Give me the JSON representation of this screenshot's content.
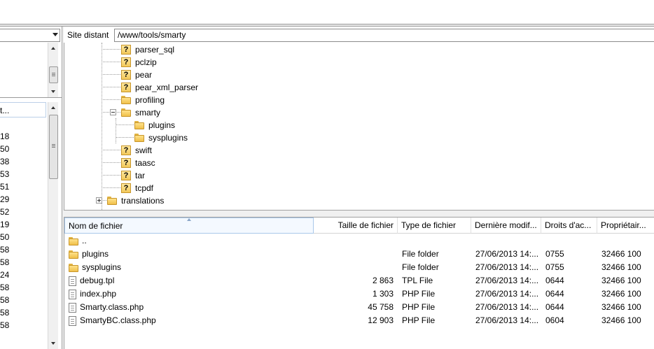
{
  "local": {
    "list_header": "t...",
    "numbers": [
      "18",
      "50",
      "38",
      "53",
      "51",
      "29",
      "52",
      "19",
      "50",
      "58",
      "58",
      "24",
      "58",
      "58",
      "58",
      "58"
    ]
  },
  "remote": {
    "site_label": "Site distant :",
    "path": "/www/tools/smarty",
    "tree": [
      {
        "name": "parser_sql",
        "icon": "unknown-folder-icon"
      },
      {
        "name": "pclzip",
        "icon": "unknown-folder-icon"
      },
      {
        "name": "pear",
        "icon": "unknown-folder-icon"
      },
      {
        "name": "pear_xml_parser",
        "icon": "unknown-folder-icon"
      },
      {
        "name": "profiling",
        "icon": "folder-icon"
      },
      {
        "name": "smarty",
        "icon": "folder-icon",
        "expanded": true
      },
      {
        "name": "plugins",
        "icon": "folder-icon"
      },
      {
        "name": "sysplugins",
        "icon": "folder-icon"
      },
      {
        "name": "swift",
        "icon": "unknown-folder-icon"
      },
      {
        "name": "taasc",
        "icon": "unknown-folder-icon"
      },
      {
        "name": "tar",
        "icon": "unknown-folder-icon"
      },
      {
        "name": "tcpdf",
        "icon": "unknown-folder-icon"
      },
      {
        "name": "translations",
        "icon": "folder-icon",
        "expandable": true
      }
    ],
    "columns": [
      "Nom de fichier",
      "Taille de fichier",
      "Type de fichier",
      "Dernière modif...",
      "Droits d'ac...",
      "Propriétair..."
    ],
    "files": [
      {
        "name": "..",
        "size": "",
        "type": "",
        "modified": "",
        "perms": "",
        "owner": "",
        "icon": "folder-icon"
      },
      {
        "name": "plugins",
        "size": "",
        "type": "File folder",
        "modified": "27/06/2013 14:...",
        "perms": "0755",
        "owner": "32466 100",
        "icon": "folder-icon"
      },
      {
        "name": "sysplugins",
        "size": "",
        "type": "File folder",
        "modified": "27/06/2013 14:...",
        "perms": "0755",
        "owner": "32466 100",
        "icon": "folder-icon"
      },
      {
        "name": "debug.tpl",
        "size": "2 863",
        "type": "TPL File",
        "modified": "27/06/2013 14:...",
        "perms": "0644",
        "owner": "32466 100",
        "icon": "file-icon"
      },
      {
        "name": "index.php",
        "size": "1 303",
        "type": "PHP File",
        "modified": "27/06/2013 14:...",
        "perms": "0644",
        "owner": "32466 100",
        "icon": "file-icon"
      },
      {
        "name": "Smarty.class.php",
        "size": "45 758",
        "type": "PHP File",
        "modified": "27/06/2013 14:...",
        "perms": "0644",
        "owner": "32466 100",
        "icon": "file-icon"
      },
      {
        "name": "SmartyBC.class.php",
        "size": "12 903",
        "type": "PHP File",
        "modified": "27/06/2013 14:...",
        "perms": "0604",
        "owner": "32466 100",
        "icon": "file-icon"
      }
    ]
  }
}
